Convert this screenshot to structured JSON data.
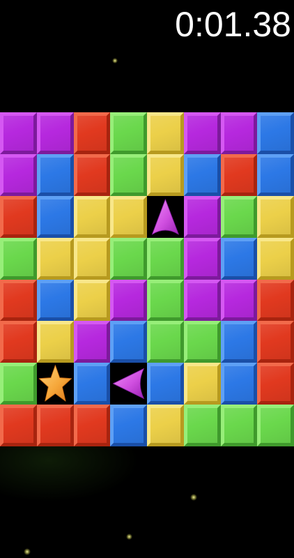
{
  "timer": {
    "text": "0:01.38"
  },
  "board": {
    "cols": 8,
    "rows": 8,
    "cells": [
      [
        "purple",
        "purple",
        "red",
        "green",
        "yellow",
        "purple",
        "purple",
        "blue"
      ],
      [
        "purple",
        "blue",
        "red",
        "green",
        "yellow",
        "blue",
        "red",
        "blue"
      ],
      [
        "red",
        "blue",
        "yellow",
        "yellow",
        "arrow-up",
        "purple",
        "green",
        "yellow"
      ],
      [
        "green",
        "yellow",
        "yellow",
        "green",
        "green",
        "purple",
        "blue",
        "yellow"
      ],
      [
        "red",
        "blue",
        "yellow",
        "purple",
        "green",
        "purple",
        "purple",
        "red"
      ],
      [
        "red",
        "yellow",
        "purple",
        "blue",
        "green",
        "green",
        "blue",
        "red"
      ],
      [
        "green",
        "star",
        "blue",
        "arrow-left",
        "blue",
        "yellow",
        "blue",
        "red"
      ],
      [
        "red",
        "red",
        "red",
        "blue",
        "yellow",
        "green",
        "green",
        "green"
      ]
    ]
  },
  "colors": {
    "red": {
      "face": "#e1391f",
      "light": "#f26a4b",
      "dark": "#a8240f"
    },
    "purple": {
      "face": "#b628de",
      "light": "#d558f2",
      "dark": "#7d1a9c"
    },
    "green": {
      "face": "#6ad84c",
      "light": "#97ee79",
      "dark": "#3f9a2c"
    },
    "yellow": {
      "face": "#ecd049",
      "light": "#f8e78a",
      "dark": "#b79a1f"
    },
    "blue": {
      "face": "#2c78e6",
      "light": "#5ea0f5",
      "dark": "#1a4fa8"
    },
    "piece_purple": "#d04fe0",
    "piece_orange": "#f6a73a"
  },
  "icons": {
    "arrow-up": "arrow-up-icon",
    "arrow-left": "arrow-left-icon",
    "star": "star-icon"
  }
}
